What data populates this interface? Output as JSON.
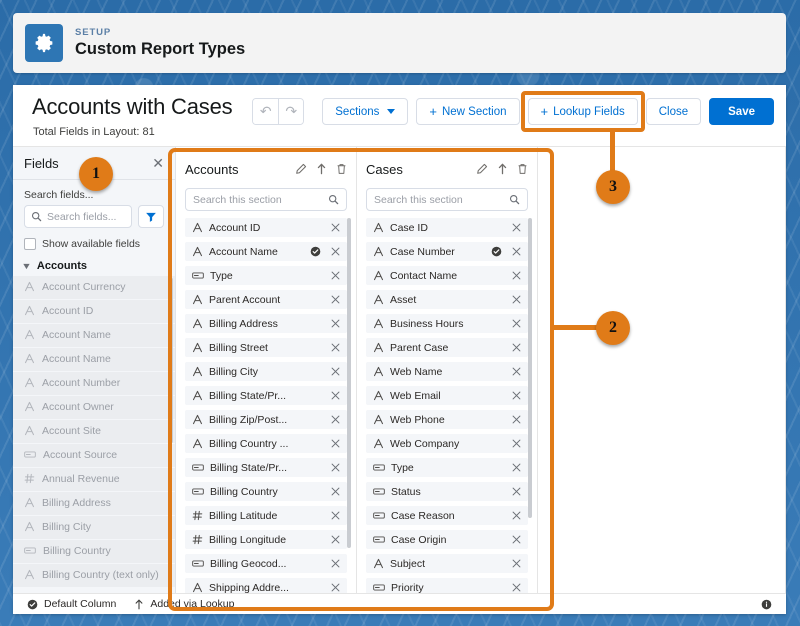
{
  "setup": {
    "eyebrow": "SETUP",
    "title": "Custom Report Types",
    "icon": "gear-icon"
  },
  "report_type": {
    "title": "Accounts with Cases",
    "subtitle": "Total Fields in Layout: 81"
  },
  "toolbar": {
    "undo_label": "↶",
    "redo_label": "↷",
    "sections_label": "Sections",
    "new_section_label": "New Section",
    "lookup_fields_label": "Lookup Fields",
    "close_label": "Close",
    "save_label": "Save",
    "plus_glyph": "+",
    "accent_color": "#0070d2"
  },
  "fields_panel": {
    "title": "Fields",
    "close_icon": "close-icon",
    "search_label": "Search fields...",
    "search_placeholder": "Search fields...",
    "filter_icon": "filter-icon",
    "show_available_label": "Show available fields",
    "group_label": "Accounts",
    "items": [
      {
        "name": "Account Currency",
        "type": "text"
      },
      {
        "name": "Account ID",
        "type": "text"
      },
      {
        "name": "Account Name",
        "type": "text"
      },
      {
        "name": "Account Name",
        "type": "text"
      },
      {
        "name": "Account Number",
        "type": "text"
      },
      {
        "name": "Account Owner",
        "type": "text"
      },
      {
        "name": "Account Site",
        "type": "text"
      },
      {
        "name": "Account Source",
        "type": "picklist"
      },
      {
        "name": "Annual Revenue",
        "type": "number"
      },
      {
        "name": "Billing Address",
        "type": "text"
      },
      {
        "name": "Billing City",
        "type": "text"
      },
      {
        "name": "Billing Country",
        "type": "picklist"
      },
      {
        "name": "Billing Country (text only)",
        "type": "text"
      }
    ]
  },
  "sections": [
    {
      "name": "Accounts",
      "edit_icon": "pencil-icon",
      "move_icon": "arrow-up-icon",
      "delete_icon": "trash-icon",
      "search_placeholder": "Search this section",
      "search_icon": "search-icon",
      "fields": [
        {
          "name": "Account ID",
          "type": "text",
          "default_column": false
        },
        {
          "name": "Account Name",
          "type": "text",
          "default_column": true
        },
        {
          "name": "Type",
          "type": "picklist",
          "default_column": false
        },
        {
          "name": "Parent Account",
          "type": "text",
          "default_column": false
        },
        {
          "name": "Billing Address",
          "type": "text",
          "default_column": false
        },
        {
          "name": "Billing Street",
          "type": "text",
          "default_column": false
        },
        {
          "name": "Billing City",
          "type": "text",
          "default_column": false
        },
        {
          "name": "Billing State/Pr...",
          "type": "text",
          "default_column": false
        },
        {
          "name": "Billing Zip/Post...",
          "type": "text",
          "default_column": false
        },
        {
          "name": "Billing Country ...",
          "type": "text",
          "default_column": false
        },
        {
          "name": "Billing State/Pr...",
          "type": "picklist",
          "default_column": false
        },
        {
          "name": "Billing Country",
          "type": "picklist",
          "default_column": false
        },
        {
          "name": "Billing Latitude",
          "type": "number",
          "default_column": false
        },
        {
          "name": "Billing Longitude",
          "type": "number",
          "default_column": false
        },
        {
          "name": "Billing Geocod...",
          "type": "picklist",
          "default_column": false
        },
        {
          "name": "Shipping Addre...",
          "type": "text",
          "default_column": false
        }
      ]
    },
    {
      "name": "Cases",
      "edit_icon": "pencil-icon",
      "move_icon": "arrow-up-icon",
      "delete_icon": "trash-icon",
      "search_placeholder": "Search this section",
      "search_icon": "search-icon",
      "fields": [
        {
          "name": "Case ID",
          "type": "text",
          "default_column": false
        },
        {
          "name": "Case Number",
          "type": "text",
          "default_column": true
        },
        {
          "name": "Contact Name",
          "type": "text",
          "default_column": false
        },
        {
          "name": "Asset",
          "type": "text",
          "default_column": false
        },
        {
          "name": "Business Hours",
          "type": "text",
          "default_column": false
        },
        {
          "name": "Parent Case",
          "type": "text",
          "default_column": false
        },
        {
          "name": "Web Name",
          "type": "text",
          "default_column": false
        },
        {
          "name": "Web Email",
          "type": "text",
          "default_column": false
        },
        {
          "name": "Web Phone",
          "type": "text",
          "default_column": false
        },
        {
          "name": "Web Company",
          "type": "text",
          "default_column": false
        },
        {
          "name": "Type",
          "type": "picklist",
          "default_column": false
        },
        {
          "name": "Status",
          "type": "picklist",
          "default_column": false
        },
        {
          "name": "Case Reason",
          "type": "picklist",
          "default_column": false
        },
        {
          "name": "Case Origin",
          "type": "picklist",
          "default_column": false
        },
        {
          "name": "Subject",
          "type": "text",
          "default_column": false
        },
        {
          "name": "Priority",
          "type": "picklist",
          "default_column": false
        }
      ]
    }
  ],
  "footer": {
    "default_column_label": "Default Column",
    "default_column_icon": "check-circle-icon",
    "added_via_lookup_label": "Added via Lookup",
    "added_via_lookup_icon": "arrow-up-icon",
    "info_icon": "info-icon"
  },
  "annotations": {
    "color": "#e07b18",
    "badges": [
      {
        "number": "1",
        "target": "fields-panel"
      },
      {
        "number": "2",
        "target": "sections-area"
      },
      {
        "number": "3",
        "target": "lookup-fields-button"
      }
    ]
  }
}
